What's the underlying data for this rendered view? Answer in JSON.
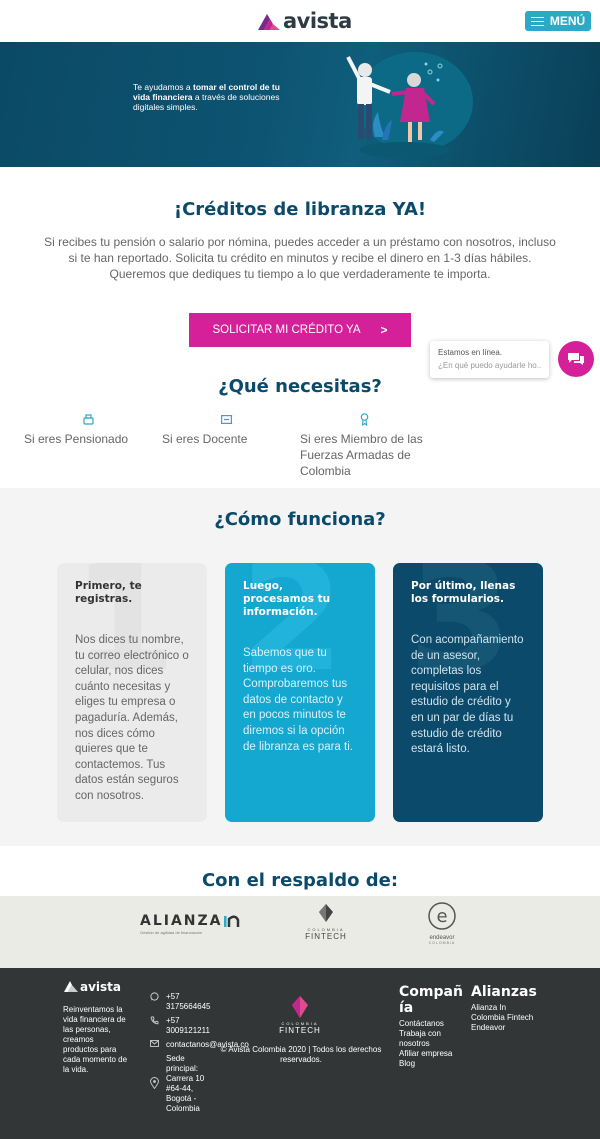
{
  "header": {
    "logo_text": "avista",
    "menu_label": "MENÚ"
  },
  "banner": {
    "text_normal_1": "Te ayudamos a ",
    "text_bold": "tomar el control de tu vida financiera",
    "text_normal_2": " a través de soluciones digitales simples."
  },
  "intro": {
    "title": "¡Créditos de libranza YA!",
    "body": "Si recibes tu pensión o salario por nómina, puedes acceder a un préstamo con nosotros, incluso si te han reportado. Solicita tu crédito en minutos y recibe el dinero en 1-3 días hábiles. Queremos que dediques tu tiempo a lo que verdaderamente te importa.",
    "cta_label": "SOLICITAR MI CRÉDITO YA",
    "cta_icon": "chevron-right-icon"
  },
  "chat": {
    "status": "Estamos en línea.",
    "placeholder": "¿En qué puedo ayudarle ho..."
  },
  "needs": {
    "title": "¿Qué necesitas?",
    "items": [
      {
        "label": "Si eres Pensionado",
        "icon": "pensioner-icon"
      },
      {
        "label": "Si eres Docente",
        "icon": "teacher-icon"
      },
      {
        "label": "Si eres Miembro de las Fuerzas Armadas de Colombia",
        "icon": "military-icon"
      }
    ]
  },
  "how": {
    "title": "¿Cómo funciona?",
    "steps": [
      {
        "number": "1",
        "title": "Primero, te registras.",
        "body": "Nos dices tu nombre, tu correo electrónico o celular, nos dices cuánto necesitas y eliges tu empresa o pagaduría. Además, nos dices cómo quieres que te contactemos. Tus datos están seguros con nosotros."
      },
      {
        "number": "2",
        "title": "Luego, procesamos tu información.",
        "body": "Sabemos que tu tiempo es oro. Comprobaremos tus datos de contacto y en pocos minutos te diremos si la opción de libranza es para ti."
      },
      {
        "number": "3",
        "title": "Por último, llenas los formularios.",
        "body": "Con acompañamiento de un asesor, completas los requisitos para el estudio de crédito y en un par de días tu estudio de crédito estará listo."
      }
    ]
  },
  "partners": {
    "title": "Con el respaldo de:",
    "alianza": "ALIANZA",
    "alianza_sub": "Gestión de agilidad de financiación",
    "fintech_top": "COLOMBIA",
    "fintech_bottom": "FINTECH",
    "endeavor": "endeavor",
    "endeavor_sub": "COLOMBIA"
  },
  "footer": {
    "logo_text": "avista",
    "tagline": "Reinventamos la vida financiera de las personas, creamos productos para cada momento de la vida.",
    "whatsapp": "+57 3175664645",
    "phone": "+57 3009121211",
    "email": "contactanos@avista.co",
    "address": "Sede principal: Carrera 10 #64-44, Bogotá - Colombia",
    "fintech_top": "COLOMBIA",
    "fintech_bottom": "FINTECH",
    "copyright": "© Avista Colombia 2020 | Todos los derechos reservados.",
    "company_title": "Compañía",
    "company_links": [
      "Contáctanos",
      "Trabaja con nosotros",
      "Afiliar empresa",
      "Blog"
    ],
    "alliances_title": "Alianzas",
    "alliances_links": [
      "Alianza In",
      "Colombia Fintech",
      "Endeavor"
    ]
  },
  "colors": {
    "brand_magenta": "#d4219a",
    "brand_navy": "#0b4a6a",
    "brand_cyan": "#14a7cf"
  }
}
